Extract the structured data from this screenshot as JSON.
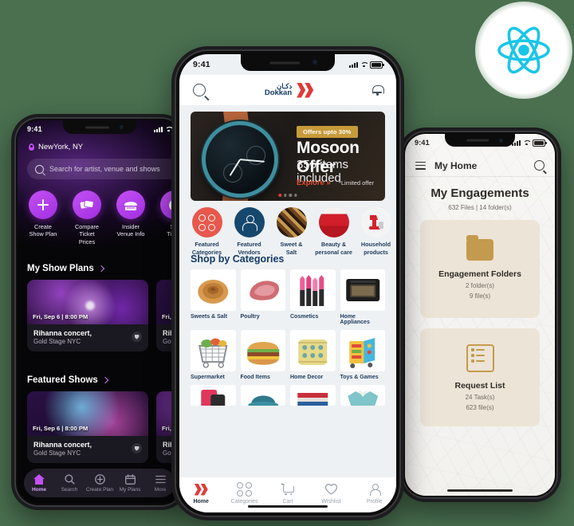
{
  "background_color": "#4a7050",
  "badge": {
    "name": "react-logo",
    "color": "#19c6e8",
    "bg": "#ffffff"
  },
  "left_phone": {
    "status": {
      "time": "9:41"
    },
    "location": "NewYork, NY",
    "search_placeholder": "Search for artist, venue and shows",
    "quick_actions": [
      {
        "label": "Create\nShow Plan",
        "icon": "plus-icon"
      },
      {
        "label": "Compare\nTicket Prices",
        "icon": "ticket-compare-icon"
      },
      {
        "label": "Insider\nVenue Info",
        "icon": "venue-icon"
      },
      {
        "label": "Set\nTimes",
        "icon": "clock-icon"
      }
    ],
    "sections": [
      {
        "title": "My Show Plans",
        "cards": [
          {
            "date": "Fri, Sep 6  |  8:00 PM",
            "title": "Rihanna concert,",
            "venue": "Gold Stage NYC"
          },
          {
            "date": "Fri, S",
            "title": "Riha",
            "venue": "Gold"
          }
        ]
      },
      {
        "title": "Featured Shows",
        "cards": [
          {
            "date": "Fri, Sep 6  |  8:00 PM",
            "title": "Rihanna concert,",
            "venue": "Gold Stage NYC"
          },
          {
            "date": "Fri, S",
            "title": "Riha",
            "venue": "Gold"
          }
        ]
      }
    ],
    "tabs": [
      {
        "label": "Home",
        "icon": "home-icon",
        "active": true
      },
      {
        "label": "Search",
        "icon": "search-icon",
        "active": false
      },
      {
        "label": "Create Plan",
        "icon": "plus-circle-icon",
        "active": false
      },
      {
        "label": "My Plans",
        "icon": "calendar-icon",
        "active": false
      },
      {
        "label": "More",
        "icon": "menu-icon",
        "active": false
      }
    ]
  },
  "center_phone": {
    "status": {
      "time": "9:41"
    },
    "header": {
      "search_icon": "search-icon",
      "bell_icon": "bell-icon",
      "logo_arabic": "دكـان",
      "logo_latin": "Dokkan",
      "logo_mark": "DD",
      "logo_color": "#e03a3a",
      "logo_text_color": "#123a63"
    },
    "banner": {
      "badge": "Offers upto 30%",
      "title": "Mosoon Offer",
      "subtitle": "356 items included",
      "cta": "Explore »",
      "note": "*Limited offer",
      "dots": 4,
      "active_dot": 0
    },
    "quick_circles": [
      {
        "label": "Featured\nCategories",
        "icon": "four-dots-icon",
        "style": "red"
      },
      {
        "label": "Featured\nVendors",
        "icon": "vendor-person-icon",
        "style": "navy"
      },
      {
        "label": "Sweet &\nSalt",
        "icon": "sweets-photo",
        "style": "photo-sweets"
      },
      {
        "label": "Beauty &\npersonal care",
        "icon": "beauty-photo",
        "style": "photo-beauty"
      },
      {
        "label": "Household\nproducts",
        "icon": "mixer-photo",
        "style": "photo-mixer"
      }
    ],
    "shop_by_title": "Shop by Categories",
    "categories": [
      {
        "label": "Sweets & Salt",
        "image": "pastry-photo"
      },
      {
        "label": "Poultry",
        "image": "meat-photo"
      },
      {
        "label": "Cosmetics",
        "image": "lipstick-photo"
      },
      {
        "label": "Home Appliances",
        "image": "oven-photo"
      },
      {
        "label": "Supermarket",
        "image": "shopping-cart-photo"
      },
      {
        "label": "Food Items",
        "image": "burger-photo"
      },
      {
        "label": "Home Decor",
        "image": "cushion-photo"
      },
      {
        "label": "Toys & Games",
        "image": "toy-blocks-photo"
      },
      {
        "label": "",
        "image": "phone-photo"
      },
      {
        "label": "",
        "image": "cap-photo"
      },
      {
        "label": "",
        "image": "books-photo"
      },
      {
        "label": "",
        "image": "clothing-photo"
      }
    ],
    "tabs": [
      {
        "label": "Home",
        "icon": "dokkan-logo-icon",
        "active": true
      },
      {
        "label": "Categories",
        "icon": "four-dots-icon",
        "active": false
      },
      {
        "label": "Cart",
        "icon": "cart-icon",
        "active": false
      },
      {
        "label": "Wishlist",
        "icon": "heart-icon",
        "active": false
      },
      {
        "label": "Profile",
        "icon": "person-icon",
        "active": false
      }
    ]
  },
  "right_phone": {
    "status": {
      "time": "9:41"
    },
    "header": {
      "menu_icon": "hamburger-icon",
      "title": "My Home",
      "search_icon": "search-icon"
    },
    "page_title": "My Engagements",
    "page_subtitle": "632 Files | 14 folder(s)",
    "tiles": [
      {
        "icon": "folder-icon",
        "name": "Engagement Folders",
        "line1": "2 folder(s)",
        "line2": "9 file(s)"
      },
      {
        "icon": "list-icon",
        "name": "Request List",
        "line1": "24 Task(s)",
        "line2": "623 file(s)"
      }
    ],
    "accent_color": "#c49a4e",
    "tile_bg": "#ece4d6"
  }
}
